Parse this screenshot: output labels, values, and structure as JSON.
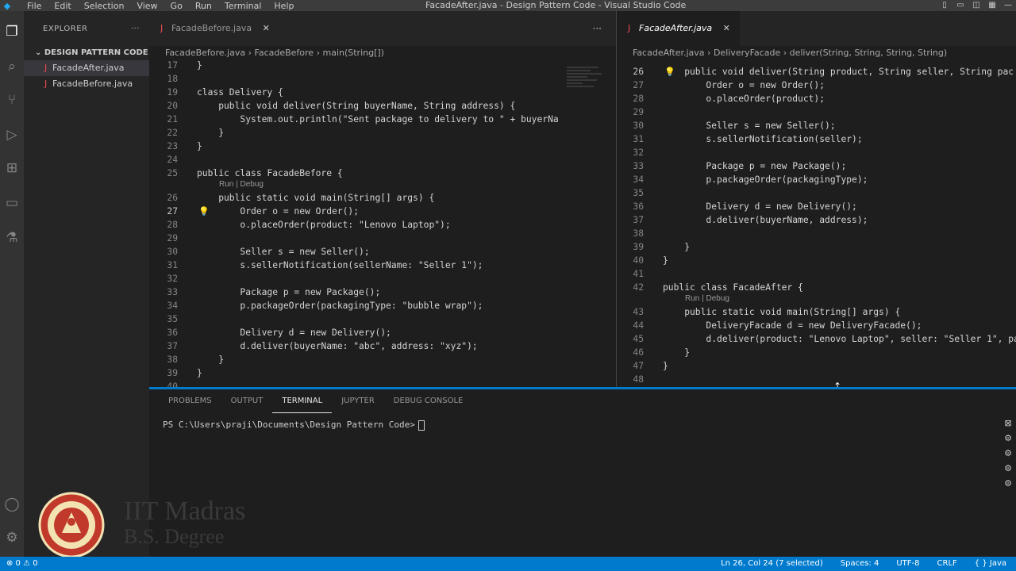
{
  "window": {
    "menu": [
      "File",
      "Edit",
      "Selection",
      "View",
      "Go",
      "Run",
      "Terminal",
      "Help"
    ],
    "title": "FacadeAfter.java - Design Pattern Code - Visual Studio Code"
  },
  "sidebar": {
    "header": "EXPLORER",
    "more": "···",
    "folder": "DESIGN PATTERN CODE",
    "files": [
      "FacadeAfter.java",
      "FacadeBefore.java"
    ]
  },
  "left_editor": {
    "tab": "FacadeBefore.java",
    "more": "···",
    "breadcrumbs": [
      "FacadeBefore.java",
      "FacadeBefore",
      "main(String[])"
    ],
    "codelens": "Run | Debug",
    "lines": [
      {
        "n": "17",
        "t": "}"
      },
      {
        "n": "18",
        "t": ""
      },
      {
        "n": "19",
        "t": "class Delivery {"
      },
      {
        "n": "20",
        "t": "    public void deliver(String buyerName, String address) {"
      },
      {
        "n": "21",
        "t": "        System.out.println(\"Sent package to delivery to \" + buyerNa"
      },
      {
        "n": "22",
        "t": "    }"
      },
      {
        "n": "23",
        "t": "}"
      },
      {
        "n": "24",
        "t": ""
      },
      {
        "n": "25",
        "t": "public class FacadeBefore {"
      },
      {
        "n": "26",
        "t": "    public static void main(String[] args) {"
      },
      {
        "n": "27",
        "t": "        Order o = new Order();"
      },
      {
        "n": "28",
        "t": "        o.placeOrder(product: \"Lenovo Laptop\");"
      },
      {
        "n": "29",
        "t": ""
      },
      {
        "n": "30",
        "t": "        Seller s = new Seller();"
      },
      {
        "n": "31",
        "t": "        s.sellerNotification(sellerName: \"Seller 1\");"
      },
      {
        "n": "32",
        "t": ""
      },
      {
        "n": "33",
        "t": "        Package p = new Package();"
      },
      {
        "n": "34",
        "t": "        p.packageOrder(packagingType: \"bubble wrap\");"
      },
      {
        "n": "35",
        "t": ""
      },
      {
        "n": "36",
        "t": "        Delivery d = new Delivery();"
      },
      {
        "n": "37",
        "t": "        d.deliver(buyerName: \"abc\", address: \"xyz\");"
      },
      {
        "n": "38",
        "t": "    }"
      },
      {
        "n": "39",
        "t": "}"
      },
      {
        "n": "40",
        "t": ""
      }
    ]
  },
  "right_editor": {
    "tab": "FacadeAfter.java",
    "close": "✕",
    "breadcrumbs": [
      "FacadeAfter.java",
      "DeliveryFacade",
      "deliver(String, String, String, String)"
    ],
    "codelens": "Run | Debug",
    "lines": [
      {
        "n": "26",
        "t": "    public void deliver(String product, String seller, String pac"
      },
      {
        "n": "27",
        "t": "        Order o = new Order();"
      },
      {
        "n": "28",
        "t": "        o.placeOrder(product);"
      },
      {
        "n": "29",
        "t": ""
      },
      {
        "n": "30",
        "t": "        Seller s = new Seller();"
      },
      {
        "n": "31",
        "t": "        s.sellerNotification(seller);"
      },
      {
        "n": "32",
        "t": ""
      },
      {
        "n": "33",
        "t": "        Package p = new Package();"
      },
      {
        "n": "34",
        "t": "        p.packageOrder(packagingType);"
      },
      {
        "n": "35",
        "t": ""
      },
      {
        "n": "36",
        "t": "        Delivery d = new Delivery();"
      },
      {
        "n": "37",
        "t": "        d.deliver(buyerName, address);"
      },
      {
        "n": "38",
        "t": ""
      },
      {
        "n": "39",
        "t": "    }"
      },
      {
        "n": "40",
        "t": "}"
      },
      {
        "n": "41",
        "t": ""
      },
      {
        "n": "42",
        "t": "public class FacadeAfter {"
      },
      {
        "n": "43",
        "t": "    public static void main(String[] args) {"
      },
      {
        "n": "44",
        "t": "        DeliveryFacade d = new DeliveryFacade();"
      },
      {
        "n": "45",
        "t": "        d.deliver(product: \"Lenovo Laptop\", seller: \"Seller 1\", pa"
      },
      {
        "n": "46",
        "t": "    }"
      },
      {
        "n": "47",
        "t": "}"
      },
      {
        "n": "48",
        "t": ""
      }
    ]
  },
  "panel": {
    "tabs": [
      "PROBLEMS",
      "OUTPUT",
      "TERMINAL",
      "JUPYTER",
      "DEBUG CONSOLE"
    ],
    "active_tab": "TERMINAL",
    "prompt": "PS C:\\Users\\praji\\Documents\\Design Pattern Code>"
  },
  "statusbar": {
    "left": "⊗ 0 ⚠ 0",
    "items": [
      "Ln 26, Col 24 (7 selected)",
      "Spaces: 4",
      "UTF-8",
      "CRLF",
      "{ } Java"
    ]
  },
  "watermark": {
    "name": "IIT Madras",
    "degree": "B.S. Degree"
  },
  "colors": {
    "accent": "#007acc",
    "titlebar": "#3c3c3c",
    "activitybar": "#333333",
    "sidebar": "#252526",
    "editor": "#1e1e1e"
  }
}
